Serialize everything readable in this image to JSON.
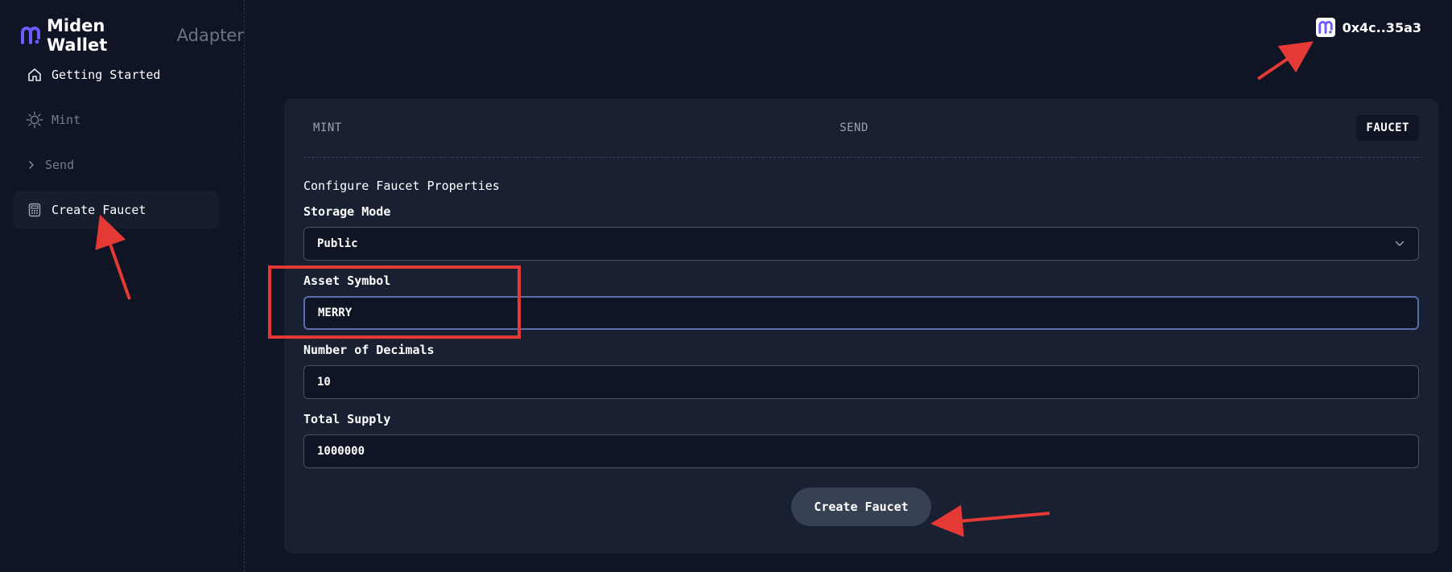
{
  "brand": {
    "name": "Miden Wallet",
    "suffix": "Adapter",
    "accent": "#6b5cff"
  },
  "sidebar": {
    "items": [
      {
        "label": "Getting Started",
        "icon": "home-icon"
      },
      {
        "label": "Mint",
        "icon": "sun-icon"
      },
      {
        "label": "Send",
        "icon": "chevron-right-icon"
      },
      {
        "label": "Create Faucet",
        "icon": "calculator-icon",
        "active": true
      }
    ]
  },
  "header": {
    "wallet_address": "0x4c..35a3",
    "wallet_icon": "miden-logo-icon"
  },
  "tabs": [
    {
      "label": "MINT"
    },
    {
      "label": "SEND"
    },
    {
      "label": "FAUCET",
      "active": true
    }
  ],
  "form": {
    "title": "Configure Faucet Properties",
    "storage_mode": {
      "label": "Storage Mode",
      "value": "Public"
    },
    "asset_symbol": {
      "label": "Asset Symbol",
      "value": "MERRY"
    },
    "decimals": {
      "label": "Number of Decimals",
      "value": "10"
    },
    "total_supply": {
      "label": "Total Supply",
      "value": "1000000"
    },
    "submit_label": "Create Faucet"
  },
  "colors": {
    "background": "#0f1524",
    "card": "#182031",
    "annotation": "#e53935",
    "button": "#374154"
  }
}
